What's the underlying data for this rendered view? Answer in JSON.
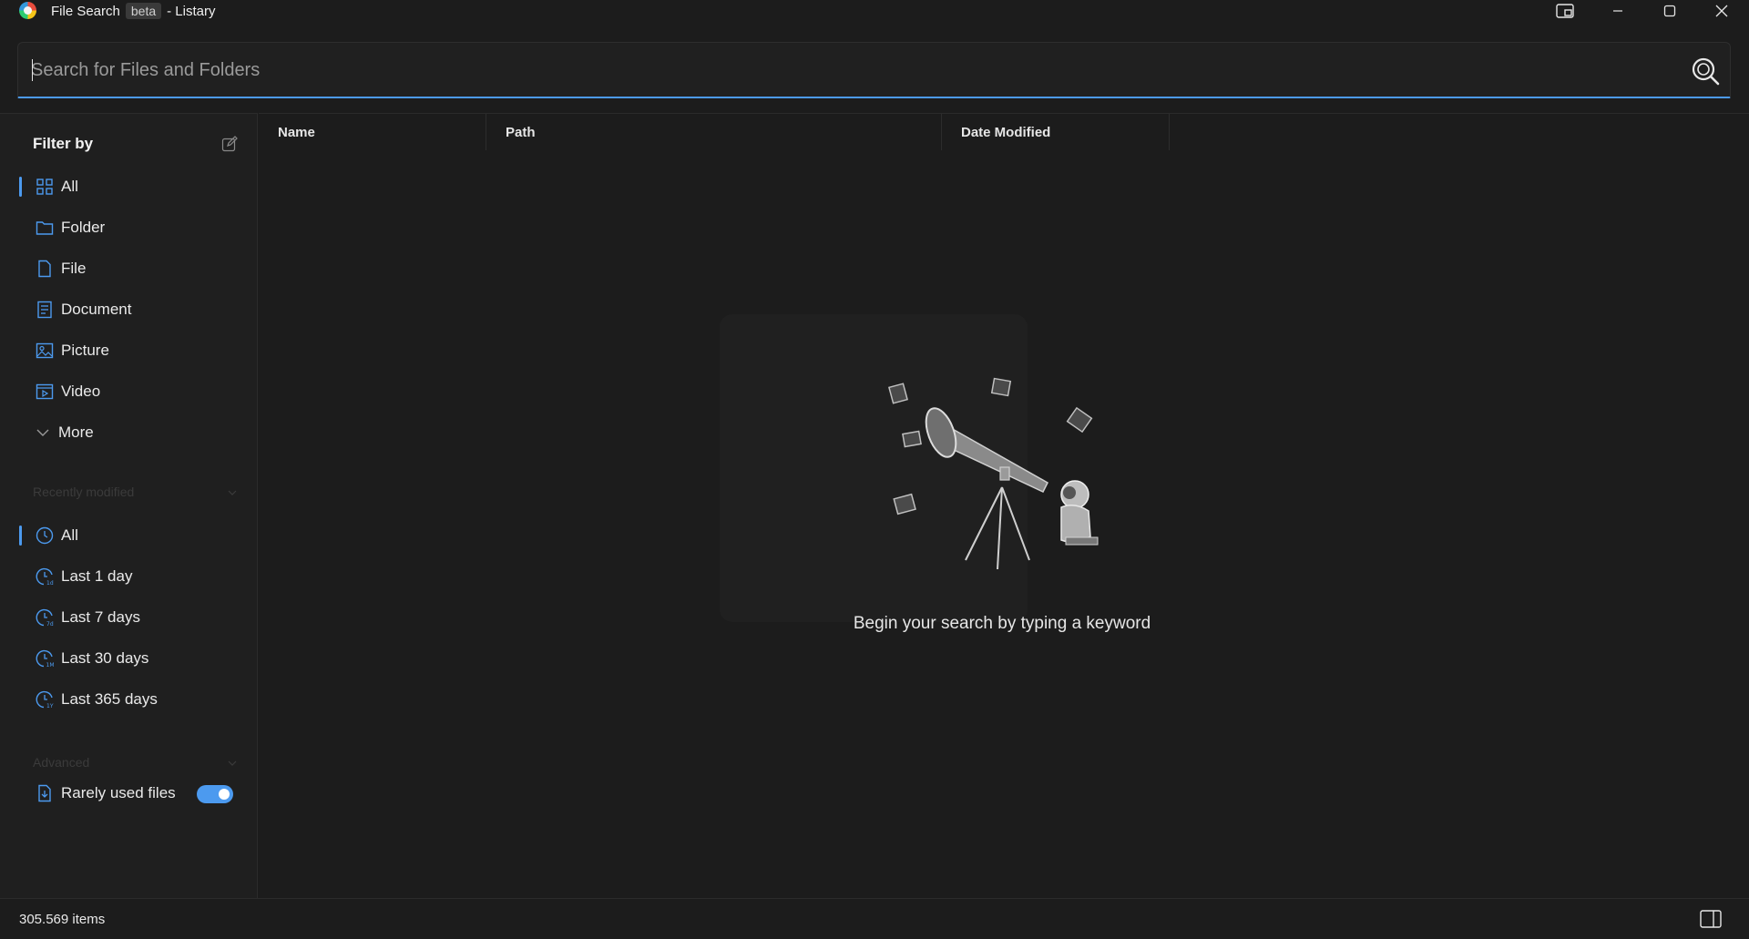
{
  "titlebar": {
    "app_name": "File Search",
    "beta_badge": "beta",
    "suffix": "- Listary",
    "buttons": [
      "snap-layout-icon",
      "minimize-icon",
      "maximize-icon",
      "close-icon"
    ]
  },
  "search": {
    "placeholder": "Search for Files and Folders",
    "value": ""
  },
  "sidebar": {
    "filter_title": "Filter by",
    "types": [
      {
        "label": "All",
        "icon": "grid-icon",
        "active": true
      },
      {
        "label": "Folder",
        "icon": "folder-icon"
      },
      {
        "label": "File",
        "icon": "file-icon"
      },
      {
        "label": "Document",
        "icon": "document-icon"
      },
      {
        "label": "Picture",
        "icon": "picture-icon"
      },
      {
        "label": "Video",
        "icon": "video-icon"
      },
      {
        "label": "More",
        "icon": "chevron-down-icon"
      }
    ],
    "recent_title": "Recently modified",
    "recent": [
      {
        "label": "All",
        "icon": "clock-icon",
        "active": true
      },
      {
        "label": "Last 1 day",
        "icon": "clock-1d-icon"
      },
      {
        "label": "Last 7 days",
        "icon": "clock-7d-icon"
      },
      {
        "label": "Last 30 days",
        "icon": "clock-1m-icon"
      },
      {
        "label": "Last 365 days",
        "icon": "clock-1y-icon"
      }
    ],
    "advanced_title": "Advanced",
    "rarely_used": {
      "label": "Rarely used files",
      "enabled": true
    }
  },
  "columns": [
    "Name",
    "Path",
    "Date Modified"
  ],
  "empty_state": {
    "message": "Begin your search by typing a keyword"
  },
  "status": {
    "count": "305.569 items"
  },
  "colors": {
    "accent": "#4c9aef",
    "background": "#1c1c1c",
    "sidebar": "#1f1f1f"
  }
}
